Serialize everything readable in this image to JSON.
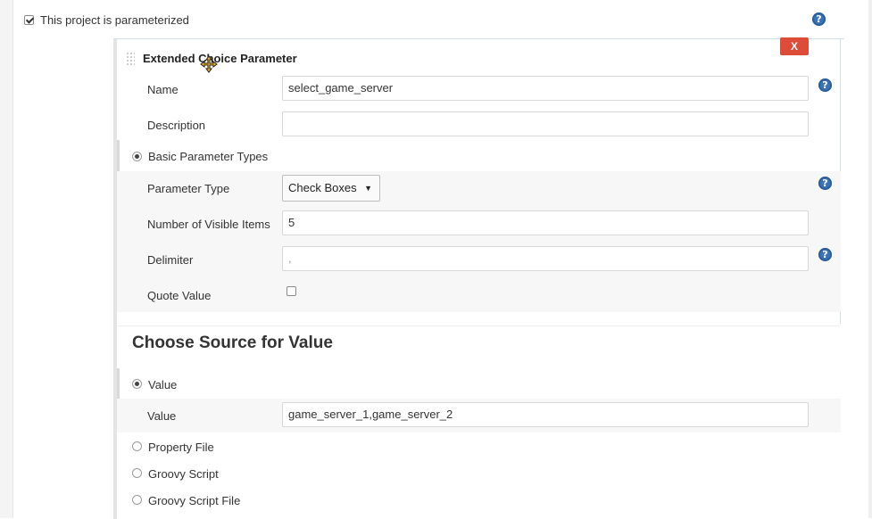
{
  "parameterized": {
    "label": "This project is parameterized",
    "checked": true
  },
  "panel": {
    "title": "Extended Choice Parameter",
    "delete_label": "X",
    "help_glyph": "?"
  },
  "fields": {
    "name": {
      "label": "Name",
      "value": "select_game_server"
    },
    "description": {
      "label": "Description",
      "value": ""
    }
  },
  "basic": {
    "radio_label": "Basic Parameter Types",
    "parameter_type": {
      "label": "Parameter Type",
      "selected": "Check Boxes"
    },
    "visible_items": {
      "label": "Number of Visible Items",
      "value": "5"
    },
    "delimiter": {
      "label": "Delimiter",
      "value": ","
    },
    "quote_value": {
      "label": "Quote Value",
      "checked": false
    }
  },
  "source": {
    "heading": "Choose Source for Value",
    "value_radio": "Value",
    "value_field": {
      "label": "Value",
      "value": "game_server_1,game_server_2"
    },
    "property_file": "Property File",
    "groovy_script": "Groovy Script",
    "groovy_script_file": "Groovy Script File"
  },
  "colors": {
    "help": "#3b73b9",
    "delete": "#dd4b39"
  }
}
